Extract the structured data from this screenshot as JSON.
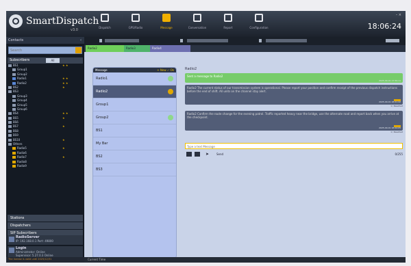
{
  "app": {
    "title": "SmartDispatch",
    "version": "v3.0",
    "clock": "18:06:24",
    "window_buttons": "– ×"
  },
  "nav": [
    {
      "label": "Dispatch",
      "icon": "dispatch-icon"
    },
    {
      "label": "GPS/Radio",
      "icon": "gps-radio-icon"
    },
    {
      "label": "Message",
      "icon": "message-icon",
      "active": true
    },
    {
      "label": "Conversation",
      "icon": "conversation-icon"
    },
    {
      "label": "Report",
      "icon": "report-icon"
    },
    {
      "label": "Configuration",
      "icon": "configuration-icon"
    }
  ],
  "sidebar": {
    "title": "Contacts",
    "search_placeholder": "Search",
    "subscribers_header": "Subscribers",
    "subscribers_tag": "All",
    "tree": [
      {
        "label": "BS1",
        "type": "folder",
        "flags": "★ ★"
      },
      {
        "label": "Group1",
        "type": "group"
      },
      {
        "label": "Group2",
        "type": "group"
      },
      {
        "label": "Radio1",
        "type": "radio",
        "flags": "★ ★"
      },
      {
        "label": "Radio2",
        "type": "radio",
        "flags": "★ ★"
      },
      {
        "label": "BS2",
        "type": "folder",
        "flags": "★"
      },
      {
        "label": "BS3",
        "type": "folder"
      },
      {
        "label": "Group3",
        "type": "group"
      },
      {
        "label": "Group4",
        "type": "group"
      },
      {
        "label": "Group5",
        "type": "group"
      },
      {
        "label": "Group6",
        "type": "group"
      },
      {
        "label": "BS4",
        "type": "folder",
        "flags": "★ ★"
      },
      {
        "label": "BS5",
        "type": "folder",
        "flags": "★"
      },
      {
        "label": "BS6",
        "type": "folder"
      },
      {
        "label": "BS7",
        "type": "folder",
        "flags": "★"
      },
      {
        "label": "BS8",
        "type": "folder"
      },
      {
        "label": "BS9",
        "type": "folder"
      },
      {
        "label": "BS10",
        "type": "folder",
        "flags": "★"
      },
      {
        "label": "Others",
        "type": "folder"
      },
      {
        "label": "Radio5",
        "type": "user",
        "flags": "★"
      },
      {
        "label": "Radio6",
        "type": "user"
      },
      {
        "label": "Radio7",
        "type": "user",
        "flags": "★"
      },
      {
        "label": "Radio8",
        "type": "user"
      },
      {
        "label": "Radio9",
        "type": "user"
      }
    ],
    "sections": [
      "Stations",
      "Dispatchers",
      "SIP Subscribers"
    ],
    "profile": {
      "name": "RadioServer",
      "line1": "IP: 192.168.0.1    Port: 49800"
    },
    "login": {
      "name": "Login",
      "line1": "Administrator: Online",
      "line2": "Supervisor: 5.27.0.3 Online"
    },
    "notice": "The license is valid until 2025/12/31"
  },
  "channel_tabs": [
    "Radio2",
    "Radio3",
    "Radio4"
  ],
  "groups": {
    "header": "Message",
    "actions": "+ New  ✓ Ok",
    "items": [
      {
        "label": "Radio1",
        "dot": true
      },
      {
        "label": "Radio2",
        "dot": true,
        "selected": true
      },
      {
        "label": "Group1"
      },
      {
        "label": "Group2",
        "dot": true
      },
      {
        "label": "BS1"
      },
      {
        "label": "My Bar"
      },
      {
        "label": "BS2"
      },
      {
        "label": "BS3"
      }
    ]
  },
  "messages": {
    "title": "Radio2",
    "items": [
      {
        "kind": "green",
        "text": "Sent a message to Radio2",
        "time": "2025-09-01 17:59:11"
      },
      {
        "kind": "dark",
        "text": "Radio2 The current status of our transmission system is operational. Please report your position and confirm receipt of the previous dispatch instructions before the end of shift. All units on the channel stay alert.",
        "time": "2025-09-01 18:01:42",
        "meta": "1 / Reached"
      },
      {
        "kind": "dark",
        "text": "Radio2 Confirm the route change for the evening patrol. Traffic reported heavy near the bridge, use the alternate road and report back when you arrive at the checkpoint.",
        "time": "2025-09-01 18:04:05",
        "meta": "1 / Reached"
      }
    ]
  },
  "composer": {
    "placeholder": "Type a text Message",
    "send_label": "Send",
    "count": "0/255"
  },
  "statusbar": {
    "text": "Current Time"
  }
}
